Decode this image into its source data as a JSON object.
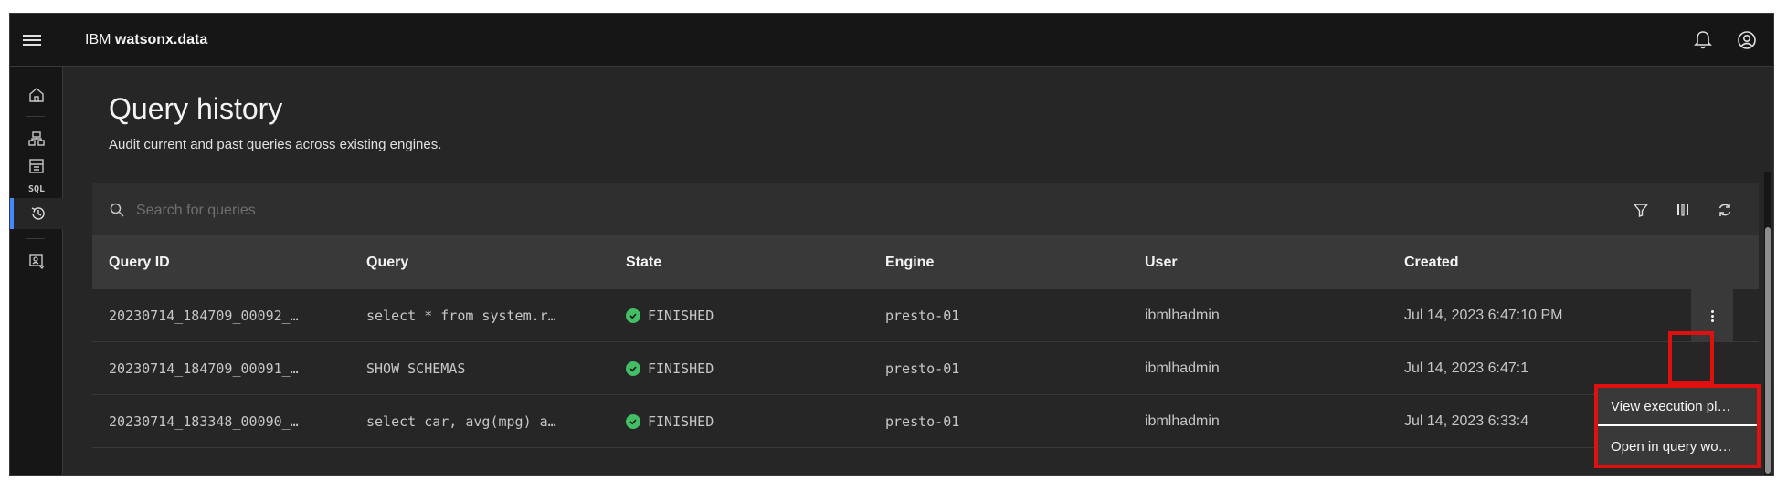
{
  "app": {
    "brand_prefix": "IBM",
    "brand_name": "watsonx.data"
  },
  "sidebar": {
    "sql_label": "SQL"
  },
  "page": {
    "title": "Query history",
    "subtitle": "Audit current and past queries across existing engines."
  },
  "search": {
    "placeholder": "Search for queries"
  },
  "table": {
    "columns": [
      "Query ID",
      "Query",
      "State",
      "Engine",
      "User",
      "Created"
    ],
    "rows": [
      {
        "id": "20230714_184709_00092_…",
        "query": "select * from system.r…",
        "state": "FINISHED",
        "engine": "presto-01",
        "user": "ibmlhadmin",
        "created": "Jul 14, 2023 6:47:10 PM"
      },
      {
        "id": "20230714_184709_00091_…",
        "query": "SHOW SCHEMAS",
        "state": "FINISHED",
        "engine": "presto-01",
        "user": "ibmlhadmin",
        "created": "Jul 14, 2023 6:47:1"
      },
      {
        "id": "20230714_183348_00090_…",
        "query": "select car, avg(mpg) a…",
        "state": "FINISHED",
        "engine": "presto-01",
        "user": "ibmlhadmin",
        "created": "Jul 14, 2023 6:33:4"
      }
    ]
  },
  "overflow_menu": {
    "items": [
      "View execution pl…",
      "Open in query wo…"
    ]
  },
  "colors": {
    "success": "#42be65",
    "highlight": "#e01010",
    "accent": "#4589ff"
  }
}
